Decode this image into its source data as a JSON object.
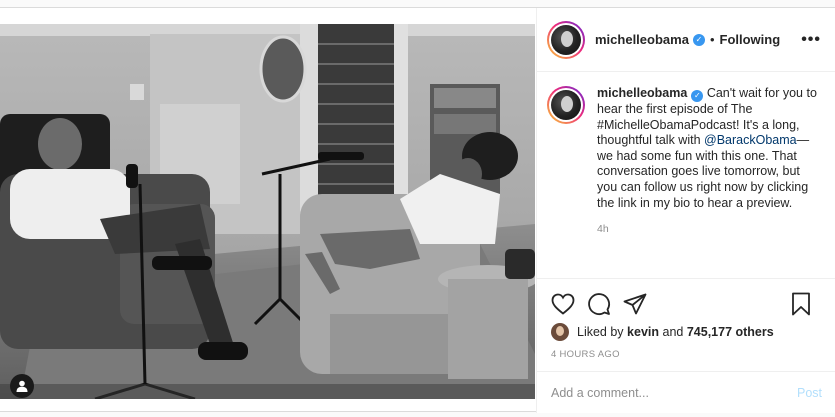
{
  "post": {
    "username": "michelleobama",
    "follow_status": "Following",
    "more_label": "•••",
    "separator": "•",
    "caption": {
      "prefix": "Can't wait for you to hear the first episode of The #MichelleObamaPodcast! It's a long, thoughtful talk with ",
      "mention": "@BarackObama",
      "suffix": "—we had some fun with this one. That conversation goes live tomorrow, but you can follow us right now by clicking the link in my bio to hear a preview."
    },
    "caption_time": "4h",
    "likes": {
      "prefix": "Liked by",
      "user": "kevin",
      "and": "and",
      "count": "745,177 others"
    },
    "time_ago": "4 HOURS AGO",
    "comment_placeholder": "Add a comment...",
    "post_button": "Post"
  },
  "icons": {
    "verified": "verified-badge-icon",
    "like": "heart-icon",
    "comment": "comment-bubble-icon",
    "share": "paper-plane-icon",
    "save": "bookmark-icon",
    "tags": "user-tag-icon"
  },
  "colors": {
    "verified": "#3897f0",
    "link": "#00376b",
    "post_button": "#b2dffc",
    "ring_start": "#f9ce34",
    "ring_mid": "#ee2a7b",
    "ring_end": "#6228d7"
  }
}
